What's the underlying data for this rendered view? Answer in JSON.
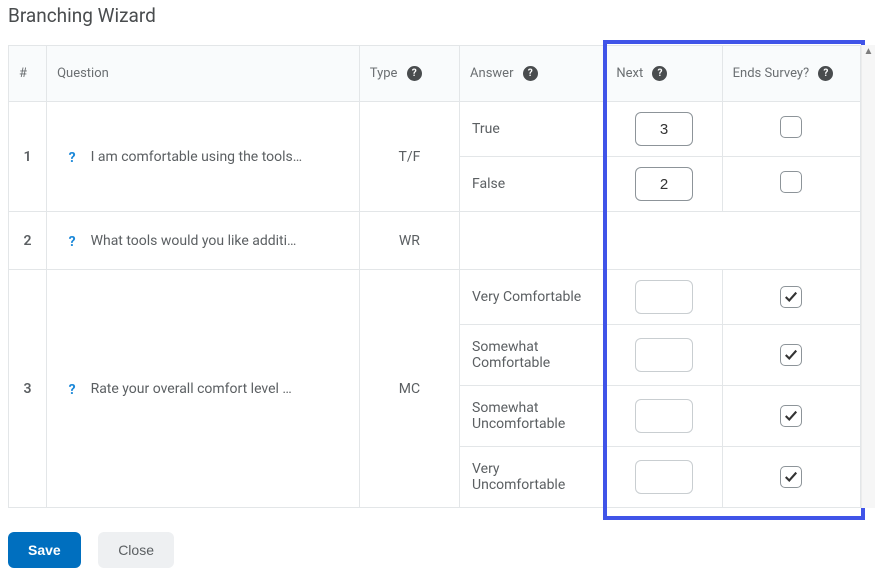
{
  "title": "Branching Wizard",
  "headers": {
    "num": "#",
    "question": "Question",
    "type": "Type",
    "answer": "Answer",
    "next": "Next",
    "ends": "Ends Survey?"
  },
  "rows": {
    "r1": {
      "num": "1",
      "question": "I am comfortable using the tools…",
      "type": "T/F",
      "answers": {
        "a0": {
          "label": "True",
          "next": "3",
          "ends": false
        },
        "a1": {
          "label": "False",
          "next": "2",
          "ends": false
        }
      }
    },
    "r2": {
      "num": "2",
      "question": "What tools would you like additi…",
      "type": "WR"
    },
    "r3": {
      "num": "3",
      "question": "Rate your overall comfort level …",
      "type": "MC",
      "answers": {
        "a0": {
          "label": "Very Comfortable",
          "next": "",
          "ends": true
        },
        "a1": {
          "label": "Somewhat Comfortable",
          "next": "",
          "ends": true
        },
        "a2": {
          "label": "Somewhat Uncomfortable",
          "next": "",
          "ends": true
        },
        "a3": {
          "label": "Very Uncomfortable",
          "next": "",
          "ends": true
        }
      }
    }
  },
  "buttons": {
    "save": "Save",
    "close": "Close"
  }
}
